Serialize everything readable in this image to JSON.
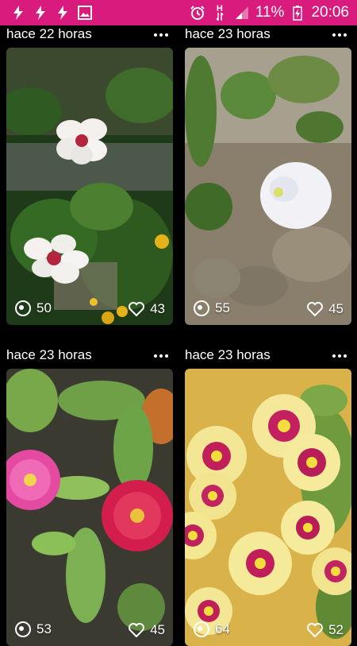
{
  "status_bar": {
    "battery_text": "11%",
    "time": "20:06",
    "network": "H",
    "left_icons": [
      "flash-icon",
      "flash-icon",
      "flash-icon",
      "image-icon"
    ],
    "right_icons": [
      "alarm-icon",
      "network-h-icon",
      "signal-icon",
      "battery-charging-icon"
    ]
  },
  "posts": [
    {
      "time": "hace 22 horas",
      "views": "50",
      "likes": "43",
      "subject": "white hibiscus flowers"
    },
    {
      "time": "hace 23 horas",
      "views": "55",
      "likes": "45",
      "subject": "white morning glory"
    },
    {
      "time": "hace 23 horas",
      "views": "53",
      "likes": "45",
      "subject": "pink ice plant flowers"
    },
    {
      "time": "hace 23 horas",
      "views": "64",
      "likes": "52",
      "subject": "yellow petunias"
    }
  ],
  "colors": {
    "status_bar": "#d81b7c",
    "background": "#000000"
  }
}
